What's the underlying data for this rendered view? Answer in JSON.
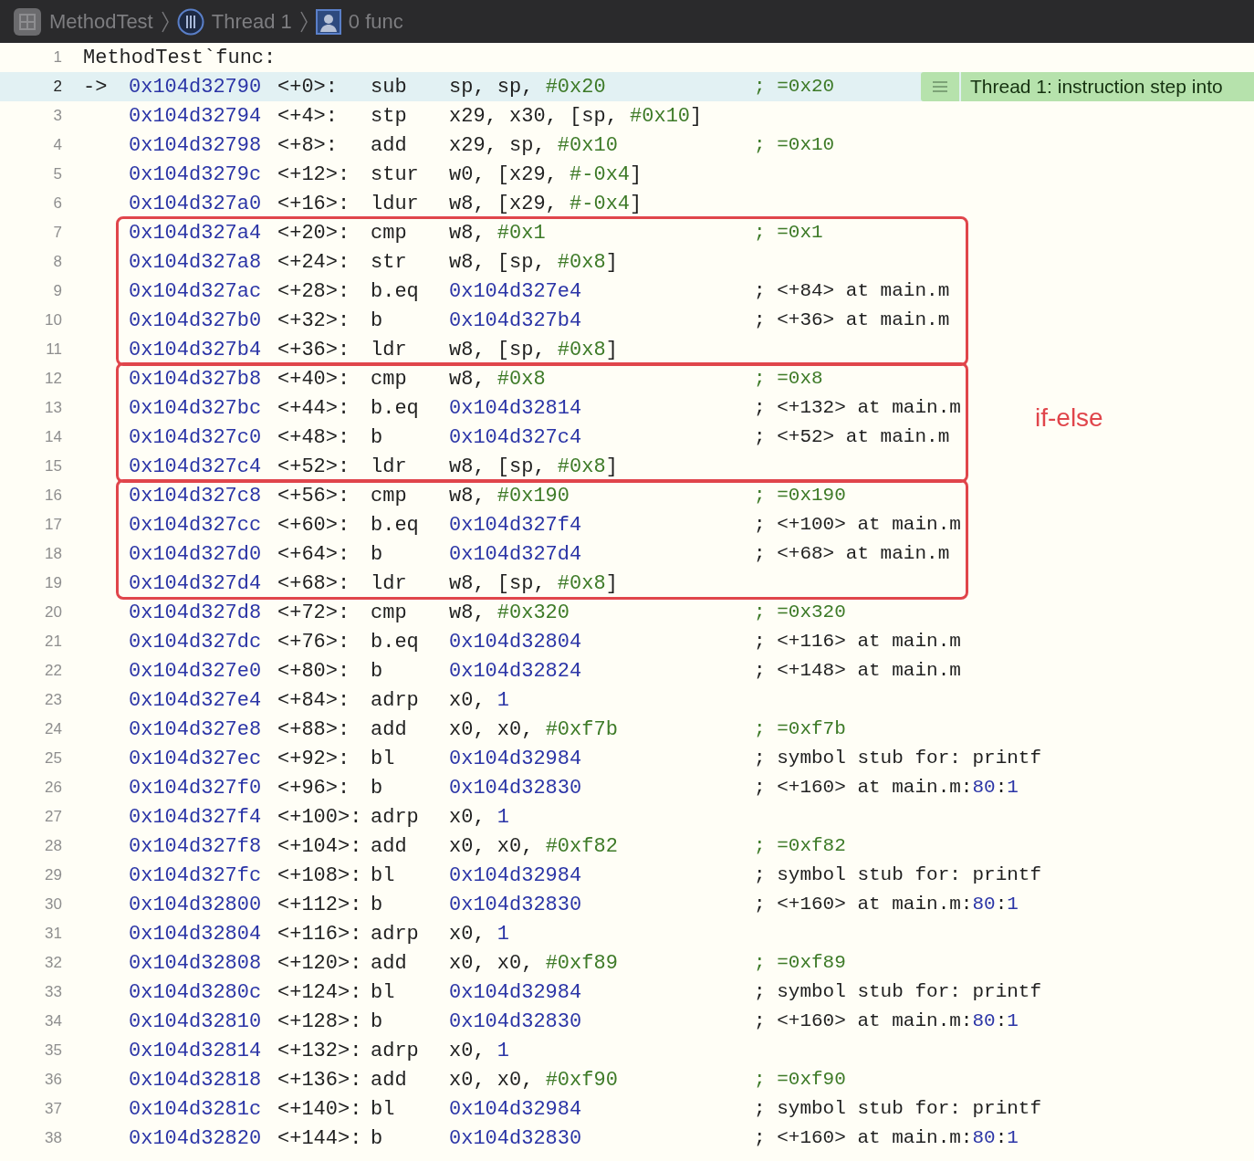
{
  "breadcrumb": [
    {
      "kind": "app",
      "label": "MethodTest"
    },
    {
      "kind": "thread",
      "label": "Thread 1"
    },
    {
      "kind": "frame",
      "label": "0 func"
    }
  ],
  "groups": [
    {
      "boxed": false,
      "rows": [
        {
          "kind": "label",
          "line": "1",
          "text": "MethodTest`func:"
        },
        {
          "kind": "instruction",
          "line": "2",
          "current": true,
          "arrow": "->",
          "address": "0x104d32790",
          "offset": "<+0>:",
          "op": "sub",
          "args": [
            {
              "kind": "plain",
              "text": "sp, sp, "
            },
            {
              "kind": "immediate",
              "text": "#0x20"
            }
          ],
          "comment": [
            {
              "kind": "immediate",
              "text": "; =0x20"
            }
          ],
          "badge": "Thread 1: instruction step into"
        },
        {
          "kind": "instruction",
          "line": "3",
          "current": false,
          "address": "0x104d32794",
          "offset": "<+4>:",
          "op": "stp",
          "args": [
            {
              "kind": "plain",
              "text": "x29, x30, [sp, "
            },
            {
              "kind": "immediate",
              "text": "#0x10"
            },
            {
              "kind": "plain",
              "text": "]"
            }
          ]
        },
        {
          "kind": "instruction",
          "line": "4",
          "current": false,
          "address": "0x104d32798",
          "offset": "<+8>:",
          "op": "add",
          "args": [
            {
              "kind": "plain",
              "text": "x29, sp, "
            },
            {
              "kind": "immediate",
              "text": "#0x10"
            }
          ],
          "comment": [
            {
              "kind": "immediate",
              "text": "; =0x10"
            }
          ]
        },
        {
          "kind": "instruction",
          "line": "5",
          "current": false,
          "address": "0x104d3279c",
          "offset": "<+12>:",
          "op": "stur",
          "args": [
            {
              "kind": "plain",
              "text": "w0, [x29, "
            },
            {
              "kind": "immediate",
              "text": "#-0x4"
            },
            {
              "kind": "plain",
              "text": "]"
            }
          ]
        },
        {
          "kind": "instruction",
          "line": "6",
          "current": false,
          "address": "0x104d327a0",
          "offset": "<+16>:",
          "op": "ldur",
          "args": [
            {
              "kind": "plain",
              "text": "w8, [x29, "
            },
            {
              "kind": "immediate",
              "text": "#-0x4"
            },
            {
              "kind": "plain",
              "text": "]"
            }
          ]
        }
      ]
    },
    {
      "boxed": true,
      "rows": [
        {
          "kind": "instruction",
          "line": "7",
          "current": false,
          "address": "0x104d327a4",
          "offset": "<+20>:",
          "op": "cmp",
          "args": [
            {
              "kind": "plain",
              "text": "w8, "
            },
            {
              "kind": "immediate",
              "text": "#0x1"
            }
          ],
          "comment": [
            {
              "kind": "immediate",
              "text": "; =0x1"
            }
          ]
        },
        {
          "kind": "instruction",
          "line": "8",
          "current": false,
          "address": "0x104d327a8",
          "offset": "<+24>:",
          "op": "str",
          "args": [
            {
              "kind": "plain",
              "text": "w8, [sp, "
            },
            {
              "kind": "immediate",
              "text": "#0x8"
            },
            {
              "kind": "plain",
              "text": "]"
            }
          ]
        },
        {
          "kind": "instruction",
          "line": "9",
          "current": false,
          "address": "0x104d327ac",
          "offset": "<+28>:",
          "op": "b.eq",
          "args": [
            {
              "kind": "number",
              "text": "0x104d327e4"
            }
          ],
          "comment": [
            {
              "kind": "plain",
              "text": "; <+84> at main.m"
            }
          ]
        },
        {
          "kind": "instruction",
          "line": "10",
          "current": false,
          "address": "0x104d327b0",
          "offset": "<+32>:",
          "op": "b",
          "args": [
            {
              "kind": "number",
              "text": "0x104d327b4"
            }
          ],
          "comment": [
            {
              "kind": "plain",
              "text": "; <+36> at main.m"
            }
          ]
        },
        {
          "kind": "instruction",
          "line": "11",
          "current": false,
          "address": "0x104d327b4",
          "offset": "<+36>:",
          "op": "ldr",
          "args": [
            {
              "kind": "plain",
              "text": "w8, [sp, "
            },
            {
              "kind": "immediate",
              "text": "#0x8"
            },
            {
              "kind": "plain",
              "text": "]"
            }
          ]
        }
      ]
    },
    {
      "boxed": true,
      "rows": [
        {
          "kind": "instruction",
          "line": "12",
          "current": false,
          "address": "0x104d327b8",
          "offset": "<+40>:",
          "op": "cmp",
          "args": [
            {
              "kind": "plain",
              "text": "w8, "
            },
            {
              "kind": "immediate",
              "text": "#0x8"
            }
          ],
          "comment": [
            {
              "kind": "immediate",
              "text": "; =0x8"
            }
          ]
        },
        {
          "kind": "instruction",
          "line": "13",
          "current": false,
          "address": "0x104d327bc",
          "offset": "<+44>:",
          "op": "b.eq",
          "args": [
            {
              "kind": "number",
              "text": "0x104d32814"
            }
          ],
          "comment": [
            {
              "kind": "plain",
              "text": "; <+132> at main.m"
            }
          ]
        },
        {
          "kind": "instruction",
          "line": "14",
          "current": false,
          "address": "0x104d327c0",
          "offset": "<+48>:",
          "op": "b",
          "args": [
            {
              "kind": "number",
              "text": "0x104d327c4"
            }
          ],
          "comment": [
            {
              "kind": "plain",
              "text": "; <+52> at main.m"
            }
          ]
        },
        {
          "kind": "instruction",
          "line": "15",
          "current": false,
          "address": "0x104d327c4",
          "offset": "<+52>:",
          "op": "ldr",
          "args": [
            {
              "kind": "plain",
              "text": "w8, [sp, "
            },
            {
              "kind": "immediate",
              "text": "#0x8"
            },
            {
              "kind": "plain",
              "text": "]"
            }
          ]
        }
      ]
    },
    {
      "boxed": true,
      "rows": [
        {
          "kind": "instruction",
          "line": "16",
          "current": false,
          "address": "0x104d327c8",
          "offset": "<+56>:",
          "op": "cmp",
          "args": [
            {
              "kind": "plain",
              "text": "w8, "
            },
            {
              "kind": "immediate",
              "text": "#0x190"
            }
          ],
          "comment": [
            {
              "kind": "immediate",
              "text": "; =0x190"
            }
          ]
        },
        {
          "kind": "instruction",
          "line": "17",
          "current": false,
          "address": "0x104d327cc",
          "offset": "<+60>:",
          "op": "b.eq",
          "args": [
            {
              "kind": "number",
              "text": "0x104d327f4"
            }
          ],
          "comment": [
            {
              "kind": "plain",
              "text": "; <+100> at main.m"
            }
          ]
        },
        {
          "kind": "instruction",
          "line": "18",
          "current": false,
          "address": "0x104d327d0",
          "offset": "<+64>:",
          "op": "b",
          "args": [
            {
              "kind": "number",
              "text": "0x104d327d4"
            }
          ],
          "comment": [
            {
              "kind": "plain",
              "text": "; <+68> at main.m"
            }
          ]
        },
        {
          "kind": "instruction",
          "line": "19",
          "current": false,
          "address": "0x104d327d4",
          "offset": "<+68>:",
          "op": "ldr",
          "args": [
            {
              "kind": "plain",
              "text": "w8, [sp, "
            },
            {
              "kind": "immediate",
              "text": "#0x8"
            },
            {
              "kind": "plain",
              "text": "]"
            }
          ]
        }
      ]
    },
    {
      "boxed": false,
      "rows": [
        {
          "kind": "instruction",
          "line": "20",
          "current": false,
          "address": "0x104d327d8",
          "offset": "<+72>:",
          "op": "cmp",
          "args": [
            {
              "kind": "plain",
              "text": "w8, "
            },
            {
              "kind": "immediate",
              "text": "#0x320"
            }
          ],
          "comment": [
            {
              "kind": "immediate",
              "text": "; =0x320"
            }
          ]
        },
        {
          "kind": "instruction",
          "line": "21",
          "current": false,
          "address": "0x104d327dc",
          "offset": "<+76>:",
          "op": "b.eq",
          "args": [
            {
              "kind": "number",
              "text": "0x104d32804"
            }
          ],
          "comment": [
            {
              "kind": "plain",
              "text": "; <+116> at main.m"
            }
          ]
        },
        {
          "kind": "instruction",
          "line": "22",
          "current": false,
          "address": "0x104d327e0",
          "offset": "<+80>:",
          "op": "b",
          "args": [
            {
              "kind": "number",
              "text": "0x104d32824"
            }
          ],
          "comment": [
            {
              "kind": "plain",
              "text": "; <+148> at main.m"
            }
          ]
        },
        {
          "kind": "instruction",
          "line": "23",
          "current": false,
          "address": "0x104d327e4",
          "offset": "<+84>:",
          "op": "adrp",
          "args": [
            {
              "kind": "plain",
              "text": "x0, "
            },
            {
              "kind": "number",
              "text": "1"
            }
          ]
        },
        {
          "kind": "instruction",
          "line": "24",
          "current": false,
          "address": "0x104d327e8",
          "offset": "<+88>:",
          "op": "add",
          "args": [
            {
              "kind": "plain",
              "text": "x0, x0, "
            },
            {
              "kind": "immediate",
              "text": "#0xf7b"
            }
          ],
          "comment": [
            {
              "kind": "immediate",
              "text": "; =0xf7b"
            }
          ]
        },
        {
          "kind": "instruction",
          "line": "25",
          "current": false,
          "address": "0x104d327ec",
          "offset": "<+92>:",
          "op": "bl",
          "args": [
            {
              "kind": "number",
              "text": "0x104d32984"
            }
          ],
          "comment": [
            {
              "kind": "plain",
              "text": "; symbol stub for: printf"
            }
          ]
        },
        {
          "kind": "instruction",
          "line": "26",
          "current": false,
          "address": "0x104d327f0",
          "offset": "<+96>:",
          "op": "b",
          "args": [
            {
              "kind": "number",
              "text": "0x104d32830"
            }
          ],
          "comment": [
            {
              "kind": "plain",
              "text": "; <+160> at main.m:"
            },
            {
              "kind": "number",
              "text": "80"
            },
            {
              "kind": "plain",
              "text": ":"
            },
            {
              "kind": "number",
              "text": "1"
            }
          ]
        },
        {
          "kind": "instruction",
          "line": "27",
          "current": false,
          "address": "0x104d327f4",
          "offset": "<+100>:",
          "op": "adrp",
          "args": [
            {
              "kind": "plain",
              "text": "x0, "
            },
            {
              "kind": "number",
              "text": "1"
            }
          ]
        },
        {
          "kind": "instruction",
          "line": "28",
          "current": false,
          "address": "0x104d327f8",
          "offset": "<+104>:",
          "op": "add",
          "args": [
            {
              "kind": "plain",
              "text": "x0, x0, "
            },
            {
              "kind": "immediate",
              "text": "#0xf82"
            }
          ],
          "comment": [
            {
              "kind": "immediate",
              "text": "; =0xf82"
            }
          ]
        },
        {
          "kind": "instruction",
          "line": "29",
          "current": false,
          "address": "0x104d327fc",
          "offset": "<+108>:",
          "op": "bl",
          "args": [
            {
              "kind": "number",
              "text": "0x104d32984"
            }
          ],
          "comment": [
            {
              "kind": "plain",
              "text": "; symbol stub for: printf"
            }
          ]
        },
        {
          "kind": "instruction",
          "line": "30",
          "current": false,
          "address": "0x104d32800",
          "offset": "<+112>:",
          "op": "b",
          "args": [
            {
              "kind": "number",
              "text": "0x104d32830"
            }
          ],
          "comment": [
            {
              "kind": "plain",
              "text": "; <+160> at main.m:"
            },
            {
              "kind": "number",
              "text": "80"
            },
            {
              "kind": "plain",
              "text": ":"
            },
            {
              "kind": "number",
              "text": "1"
            }
          ]
        },
        {
          "kind": "instruction",
          "line": "31",
          "current": false,
          "address": "0x104d32804",
          "offset": "<+116>:",
          "op": "adrp",
          "args": [
            {
              "kind": "plain",
              "text": "x0, "
            },
            {
              "kind": "number",
              "text": "1"
            }
          ]
        },
        {
          "kind": "instruction",
          "line": "32",
          "current": false,
          "address": "0x104d32808",
          "offset": "<+120>:",
          "op": "add",
          "args": [
            {
              "kind": "plain",
              "text": "x0, x0, "
            },
            {
              "kind": "immediate",
              "text": "#0xf89"
            }
          ],
          "comment": [
            {
              "kind": "immediate",
              "text": "; =0xf89"
            }
          ]
        },
        {
          "kind": "instruction",
          "line": "33",
          "current": false,
          "address": "0x104d3280c",
          "offset": "<+124>:",
          "op": "bl",
          "args": [
            {
              "kind": "number",
              "text": "0x104d32984"
            }
          ],
          "comment": [
            {
              "kind": "plain",
              "text": "; symbol stub for: printf"
            }
          ]
        },
        {
          "kind": "instruction",
          "line": "34",
          "current": false,
          "address": "0x104d32810",
          "offset": "<+128>:",
          "op": "b",
          "args": [
            {
              "kind": "number",
              "text": "0x104d32830"
            }
          ],
          "comment": [
            {
              "kind": "plain",
              "text": "; <+160> at main.m:"
            },
            {
              "kind": "number",
              "text": "80"
            },
            {
              "kind": "plain",
              "text": ":"
            },
            {
              "kind": "number",
              "text": "1"
            }
          ]
        },
        {
          "kind": "instruction",
          "line": "35",
          "current": false,
          "address": "0x104d32814",
          "offset": "<+132>:",
          "op": "adrp",
          "args": [
            {
              "kind": "plain",
              "text": "x0, "
            },
            {
              "kind": "number",
              "text": "1"
            }
          ]
        },
        {
          "kind": "instruction",
          "line": "36",
          "current": false,
          "address": "0x104d32818",
          "offset": "<+136>:",
          "op": "add",
          "args": [
            {
              "kind": "plain",
              "text": "x0, x0, "
            },
            {
              "kind": "immediate",
              "text": "#0xf90"
            }
          ],
          "comment": [
            {
              "kind": "immediate",
              "text": "; =0xf90"
            }
          ]
        },
        {
          "kind": "instruction",
          "line": "37",
          "current": false,
          "address": "0x104d3281c",
          "offset": "<+140>:",
          "op": "bl",
          "args": [
            {
              "kind": "number",
              "text": "0x104d32984"
            }
          ],
          "comment": [
            {
              "kind": "plain",
              "text": "; symbol stub for: printf"
            }
          ]
        },
        {
          "kind": "instruction",
          "line": "38",
          "current": false,
          "address": "0x104d32820",
          "offset": "<+144>:",
          "op": "b",
          "args": [
            {
              "kind": "number",
              "text": "0x104d32830"
            }
          ],
          "comment": [
            {
              "kind": "plain",
              "text": "; <+160> at main.m:"
            },
            {
              "kind": "number",
              "text": "80"
            },
            {
              "kind": "plain",
              "text": ":"
            },
            {
              "kind": "number",
              "text": "1"
            }
          ]
        }
      ]
    }
  ],
  "annotation_label": "if-else"
}
